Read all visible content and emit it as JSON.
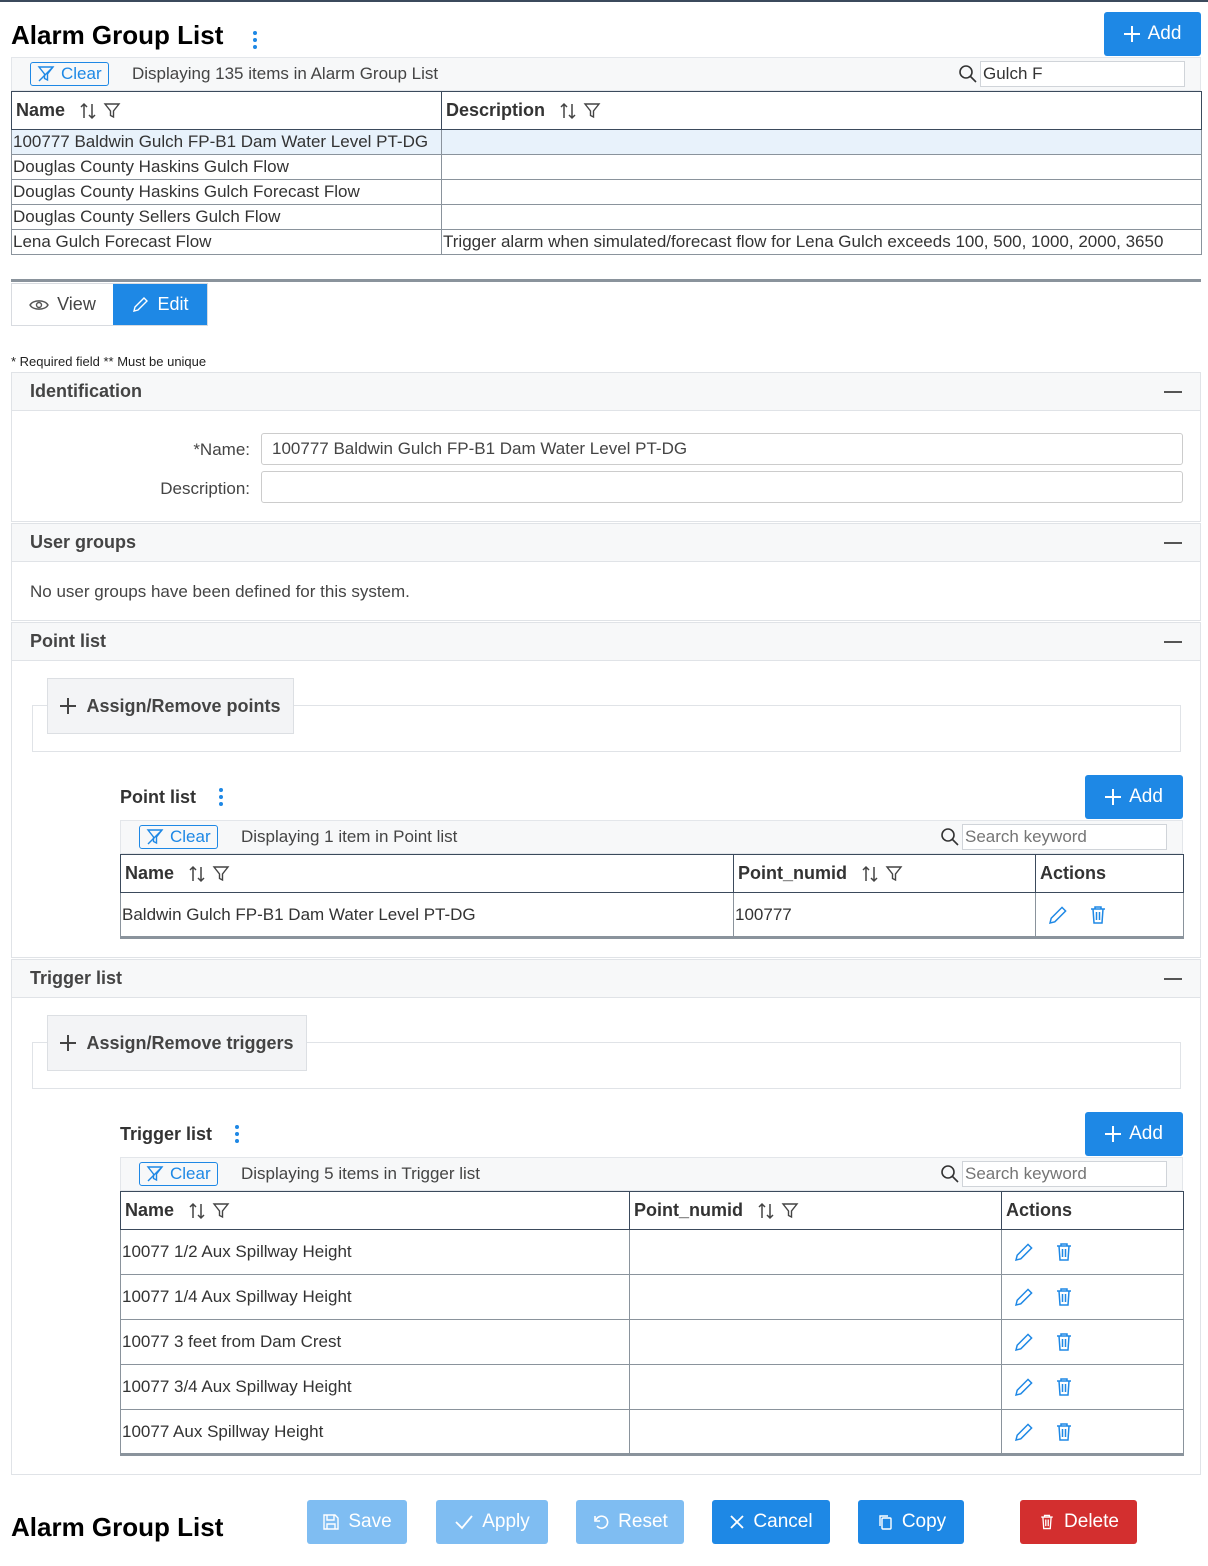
{
  "header": {
    "title": "Alarm Group List",
    "add_label": "Add"
  },
  "list_toolbar": {
    "clear_label": "Clear",
    "status": "Displaying 135 items in Alarm Group List",
    "search_value": "Gulch F"
  },
  "list_table": {
    "columns": [
      "Name",
      "Description"
    ],
    "rows": [
      {
        "name": "100777 Baldwin Gulch FP-B1 Dam Water Level PT-DG",
        "description": ""
      },
      {
        "name": "Douglas County Haskins Gulch Flow",
        "description": ""
      },
      {
        "name": "Douglas County Haskins Gulch Forecast Flow",
        "description": ""
      },
      {
        "name": "Douglas County Sellers Gulch Flow",
        "description": ""
      },
      {
        "name": "Lena Gulch Forecast Flow",
        "description": "Trigger alarm when simulated/forecast flow for Lena Gulch exceeds 100, 500, 1000, 2000, 3650"
      }
    ]
  },
  "mode_tabs": {
    "view_label": "View",
    "edit_label": "Edit"
  },
  "required_note": "* Required field ** Must be unique",
  "identification": {
    "title": "Identification",
    "name_label": "*Name:",
    "name_value": "100777 Baldwin Gulch FP-B1 Dam Water Level PT-DG",
    "description_label": "Description:",
    "description_value": ""
  },
  "user_groups": {
    "title": "User groups",
    "message": "No user groups have been defined for this system."
  },
  "point_section": {
    "title": "Point list",
    "assign_label": "Assign/Remove points",
    "sub_title": "Point list",
    "add_label": "Add",
    "clear_label": "Clear",
    "status": "Displaying 1 item in Point list",
    "search_placeholder": "Search keyword",
    "columns": [
      "Name",
      "Point_numid",
      "Actions"
    ],
    "rows": [
      {
        "name": "Baldwin Gulch FP-B1 Dam Water Level PT-DG",
        "numid": "100777"
      }
    ]
  },
  "trigger_section": {
    "title": "Trigger list",
    "assign_label": "Assign/Remove triggers",
    "sub_title": "Trigger list",
    "add_label": "Add",
    "clear_label": "Clear",
    "status": "Displaying 5 items in Trigger list",
    "search_placeholder": "Search keyword",
    "columns": [
      "Name",
      "Point_numid",
      "Actions"
    ],
    "rows": [
      {
        "name": "10077 1/2 Aux Spillway Height",
        "numid": ""
      },
      {
        "name": "10077 1/4 Aux Spillway Height",
        "numid": ""
      },
      {
        "name": "10077 3 feet from Dam Crest",
        "numid": ""
      },
      {
        "name": "10077 3/4 Aux Spillway Height",
        "numid": ""
      },
      {
        "name": "10077 Aux Spillway Height",
        "numid": ""
      }
    ]
  },
  "footer": {
    "title": "Alarm Group List",
    "save_label": "Save",
    "apply_label": "Apply",
    "reset_label": "Reset",
    "cancel_label": "Cancel",
    "copy_label": "Copy",
    "delete_label": "Delete"
  },
  "colors": {
    "primary": "#1e88e5",
    "primary_disabled": "#7fbdf2",
    "danger": "#d32f2f",
    "selected_row": "#e8f2fb"
  }
}
